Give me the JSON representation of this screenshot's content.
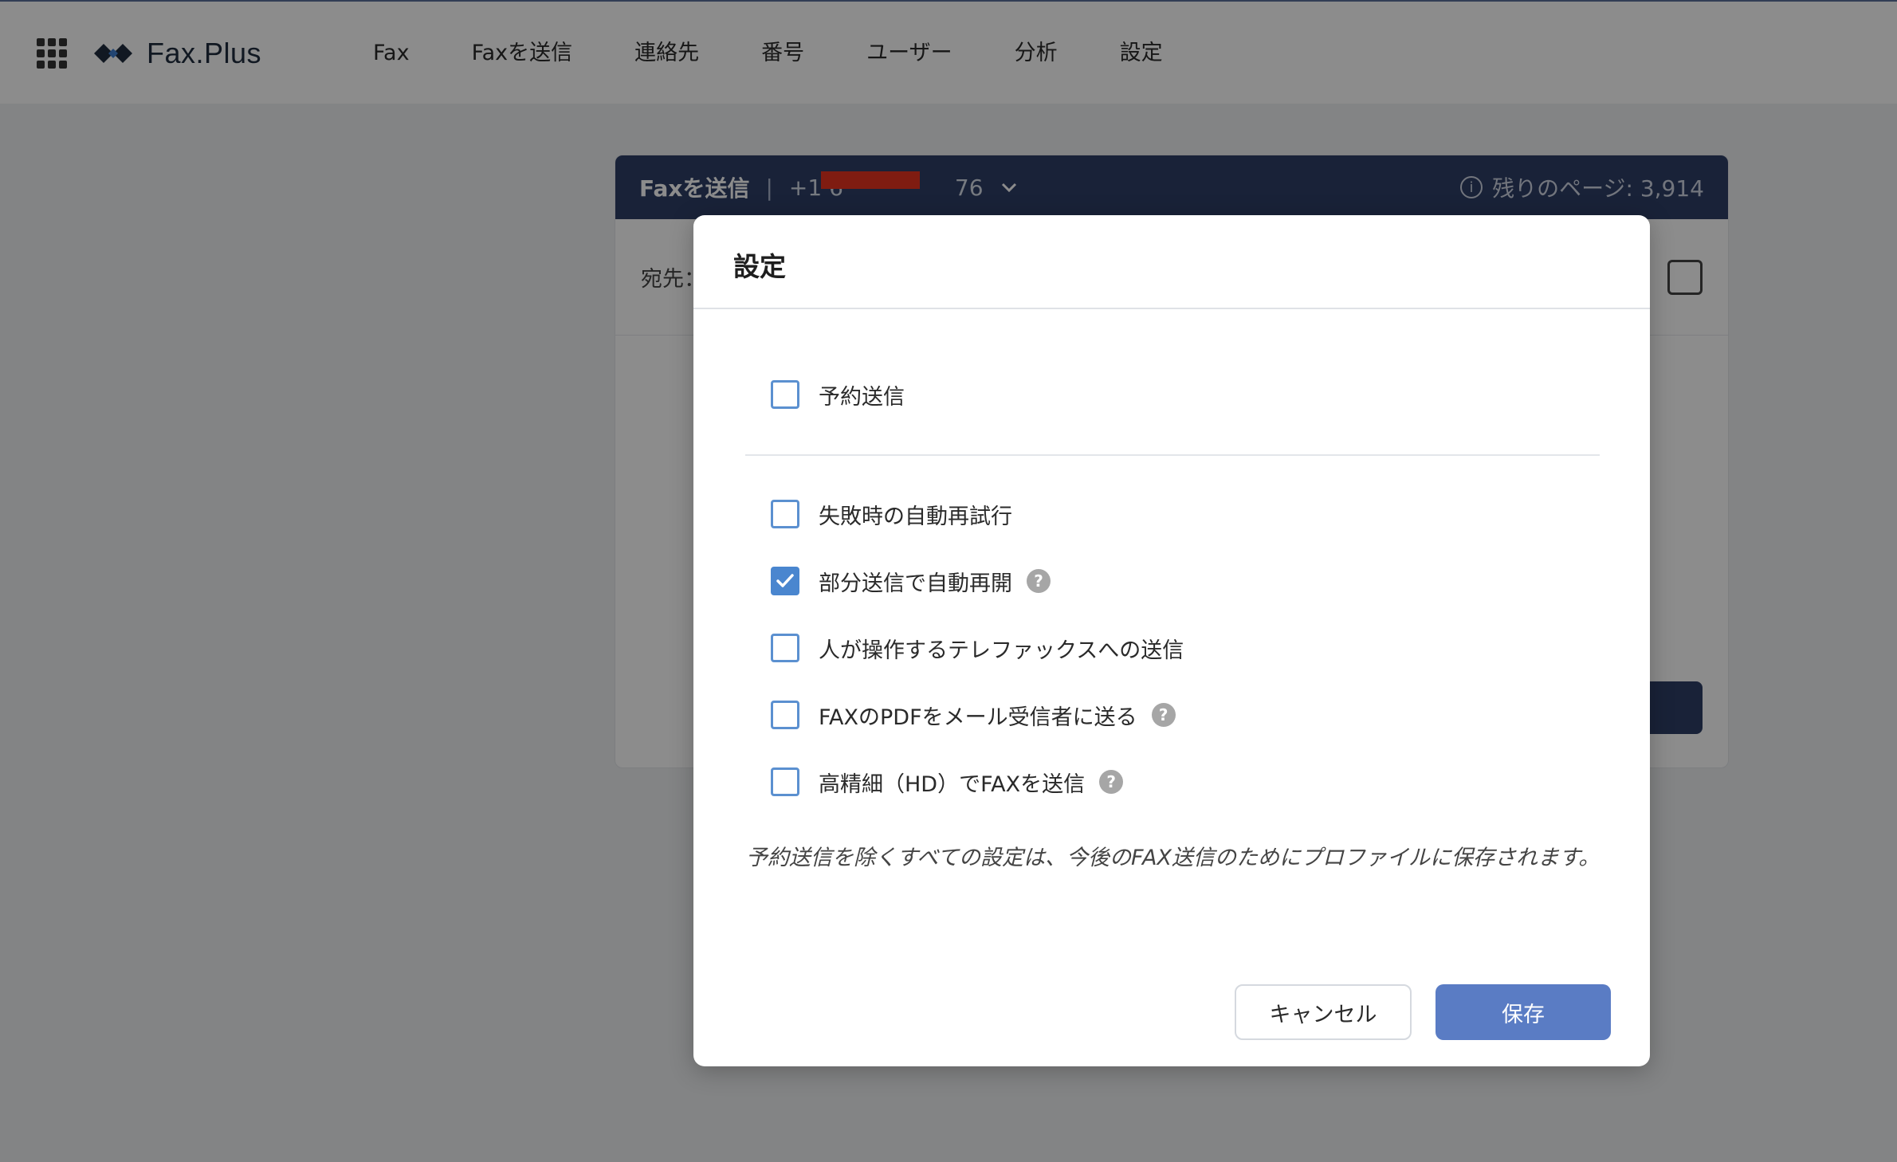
{
  "app": {
    "name": "Fax.Plus"
  },
  "nav": {
    "items": [
      "Fax",
      "Faxを送信",
      "連絡先",
      "番号",
      "ユーザー",
      "分析",
      "設定"
    ]
  },
  "background_card": {
    "title": "Faxを送信",
    "separator": "|",
    "number_prefix": "+1 6",
    "number_suffix": "76",
    "remaining_pages": "残りのページ: 3,914",
    "recipient_label": "宛先："
  },
  "dialog": {
    "title": "設定",
    "options": [
      {
        "label": "予約送信",
        "checked": false,
        "help": false
      },
      {
        "label": "失敗時の自動再試行",
        "checked": false,
        "help": false
      },
      {
        "label": "部分送信で自動再開",
        "checked": true,
        "help": true
      },
      {
        "label": "人が操作するテレファックスへの送信",
        "checked": false,
        "help": false
      },
      {
        "label": "FAXのPDFをメール受信者に送る",
        "checked": false,
        "help": true
      },
      {
        "label": "高精細（HD）でFAXを送信",
        "checked": false,
        "help": true
      }
    ],
    "help_glyph": "?",
    "note": "予約送信を除くすべての設定は、今後のFAX送信のためにプロファイルに保存されます。",
    "cancel_label": "キャンセル",
    "save_label": "保存"
  },
  "colors": {
    "header_bg": "#2e3f66",
    "checkbox_border": "#5b90d0",
    "checkbox_checked": "#4a86cf",
    "save_button": "#5a7cc4"
  }
}
